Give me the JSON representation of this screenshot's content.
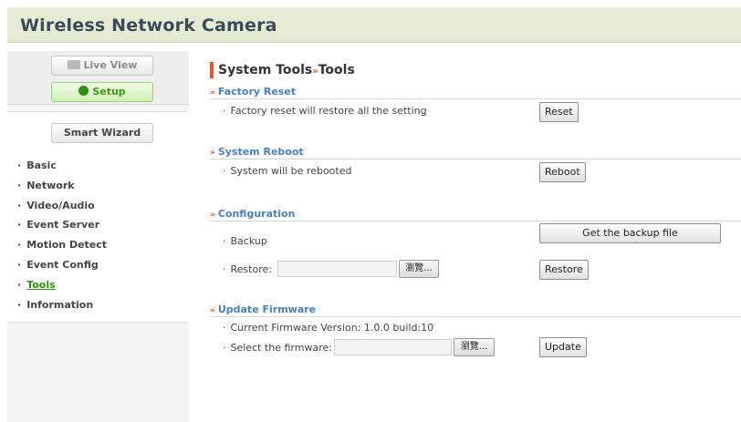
{
  "app": {
    "title": "Wireless Network Camera"
  },
  "sidebar": {
    "live_view": "Live View",
    "setup": "Setup",
    "smart_wizard": "Smart Wizard",
    "bullet": "·",
    "items": [
      {
        "label": "Basic"
      },
      {
        "label": "Network"
      },
      {
        "label": "Video/Audio"
      },
      {
        "label": "Event Server"
      },
      {
        "label": "Motion Detect"
      },
      {
        "label": "Event Config"
      },
      {
        "label": "Tools",
        "active": true
      },
      {
        "label": "Information"
      }
    ]
  },
  "main": {
    "title_part1": "System Tools",
    "title_sep": "»",
    "title_part2": "Tools",
    "section_arrow": "»",
    "bullet": "·",
    "factory_reset": {
      "heading": "Factory Reset",
      "desc": "Factory reset will restore all the setting",
      "button": "Reset"
    },
    "system_reboot": {
      "heading": "System Reboot",
      "desc": "System will be rebooted",
      "button": "Reboot"
    },
    "configuration": {
      "heading": "Configuration",
      "backup_label": "Backup",
      "backup_button": "Get the backup file",
      "restore_label": "Restore:",
      "restore_field": "",
      "browse": "瀏覽...",
      "restore_button": "Restore"
    },
    "update_firmware": {
      "heading": "Update Firmware",
      "version_label": "Current Firmware Version:",
      "version_value": "1.0.0 build:10",
      "select_label": "Select the firmware:",
      "select_field": "",
      "browse": "瀏覽...",
      "button": "Update"
    }
  },
  "colors": {
    "header_bg": "#e7ebd4",
    "accent_orange": "#e2572b",
    "section_blue": "#4a7fbf",
    "active_green": "#2f8d15"
  }
}
